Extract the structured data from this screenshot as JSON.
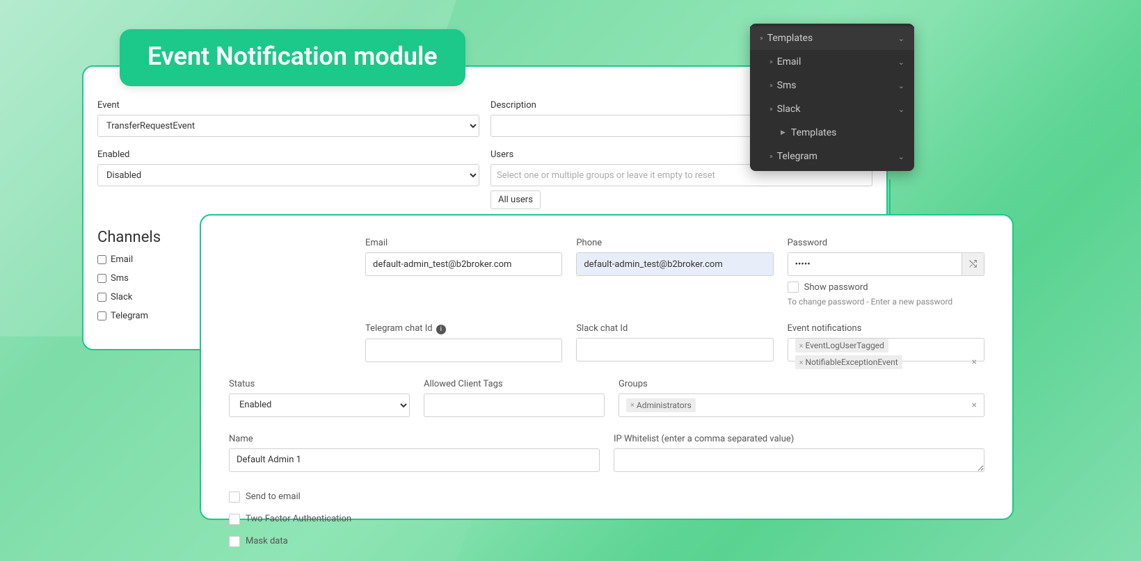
{
  "title": "Event Notification module",
  "panel1": {
    "event_label": "Event",
    "event_value": "TransferRequestEvent",
    "description_label": "Description",
    "description_value": "",
    "enabled_label": "Enabled",
    "enabled_value": "Disabled",
    "users_label": "Users",
    "users_placeholder": "Select one or multiple groups or leave it empty to reset",
    "all_users_btn": "All users",
    "channels_heading": "Channels",
    "channels": [
      "Email",
      "Sms",
      "Slack",
      "Telegram"
    ]
  },
  "sidebar": {
    "items": [
      {
        "label": "Templates",
        "level": 0,
        "icon": "dbl",
        "expand": true
      },
      {
        "label": "Email",
        "level": 1,
        "icon": "dbl",
        "expand": true
      },
      {
        "label": "Sms",
        "level": 1,
        "icon": "dbl",
        "expand": true
      },
      {
        "label": "Slack",
        "level": 1,
        "icon": "dbl",
        "expand": true
      },
      {
        "label": "Templates",
        "level": 2,
        "icon": "tri",
        "expand": false
      },
      {
        "label": "Telegram",
        "level": 1,
        "icon": "dbl",
        "expand": true
      }
    ]
  },
  "panel2": {
    "email_label": "Email",
    "email_value": "default-admin_test@b2broker.com",
    "phone_label": "Phone",
    "phone_value": "default-admin_test@b2broker.com",
    "password_label": "Password",
    "password_value": "•••••",
    "show_password_label": "Show password",
    "password_hint": "To change password - Enter a new password",
    "telegram_label": "Telegram chat Id",
    "telegram_value": "",
    "slack_label": "Slack chat Id",
    "slack_value": "",
    "event_notif_label": "Event notifications",
    "event_notif_tags": [
      "EventLogUserTagged",
      "NotifiableExceptionEvent"
    ],
    "status_label": "Status",
    "status_value": "Enabled",
    "allowed_tags_label": "Allowed Client Tags",
    "allowed_tags_value": "",
    "groups_label": "Groups",
    "groups_tags": [
      "Administrators"
    ],
    "name_label": "Name",
    "name_value": "Default Admin 1",
    "ip_label": "IP Whitelist (enter a comma separated value)",
    "ip_value": "",
    "send_email_label": "Send to email",
    "two_factor_label": "Two Factor Authentication",
    "mask_data_label": "Mask data"
  }
}
